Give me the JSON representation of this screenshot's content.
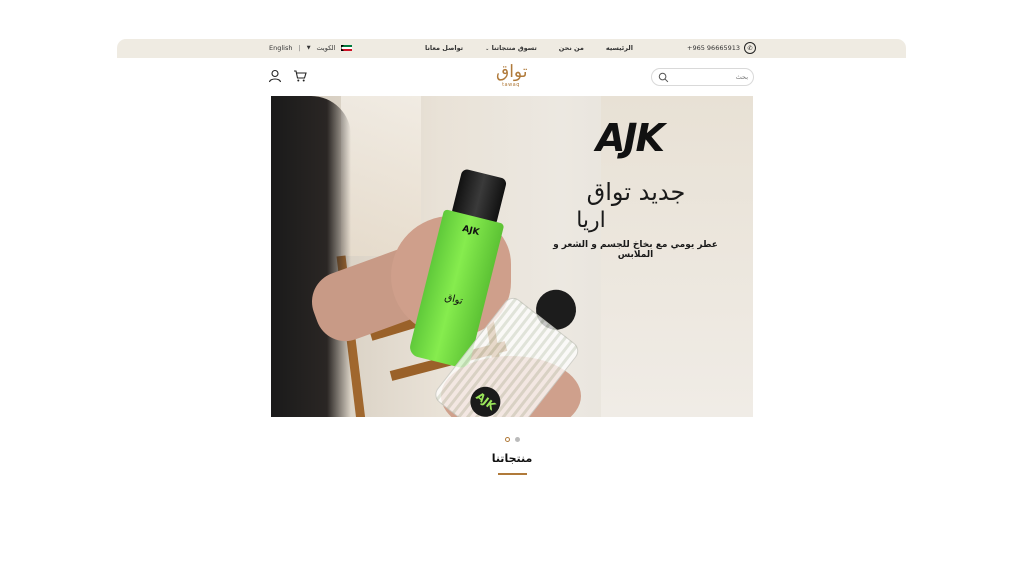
{
  "topbar": {
    "language": "English",
    "separator": "|",
    "country": "الكويت",
    "nav": {
      "contact": "تواصل معانا",
      "shop": "تسوق منتجاتنا",
      "about": "من نحن",
      "home": "الرئيسيه"
    },
    "phone": "+965 96665913"
  },
  "header": {
    "logo_ar": "تواق",
    "logo_en": "tawaq",
    "search_placeholder": "بحث"
  },
  "banner": {
    "brand": "AJK",
    "headline": "جديد تواق",
    "subheadline": "اريا",
    "tagline": "عطر يومي مع بخاخ للجسم و الشعر و الملابس",
    "bottle_logo": "AJK",
    "bottle_brand": "تواق",
    "badge": "AJK"
  },
  "slider": {
    "active_index": 0,
    "count": 2
  },
  "section": {
    "title": "منتجاتنا"
  },
  "colors": {
    "accent": "#b07a3a",
    "topbar_bg": "#efebe2"
  }
}
